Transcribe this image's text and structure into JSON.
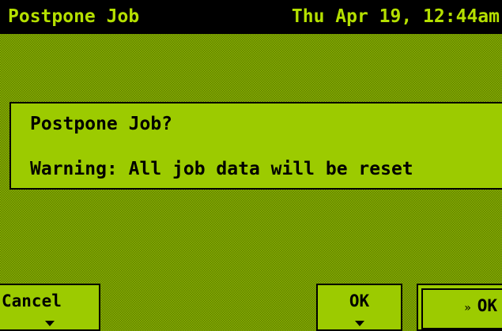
{
  "header": {
    "title": "Postpone Job",
    "datetime": "Thu Apr 19, 12:44am"
  },
  "dialog": {
    "question": "Postpone Job?",
    "warning": "Warning: All job data will be reset"
  },
  "softkeys": {
    "cancel_label": "Cancel",
    "ok_label": "OK",
    "ok2_label": "OK",
    "ok2_icon": "»"
  },
  "colors": {
    "screen_green": "#9ccb00",
    "title_text": "#b5e000",
    "titlebar_bg": "#000000"
  }
}
